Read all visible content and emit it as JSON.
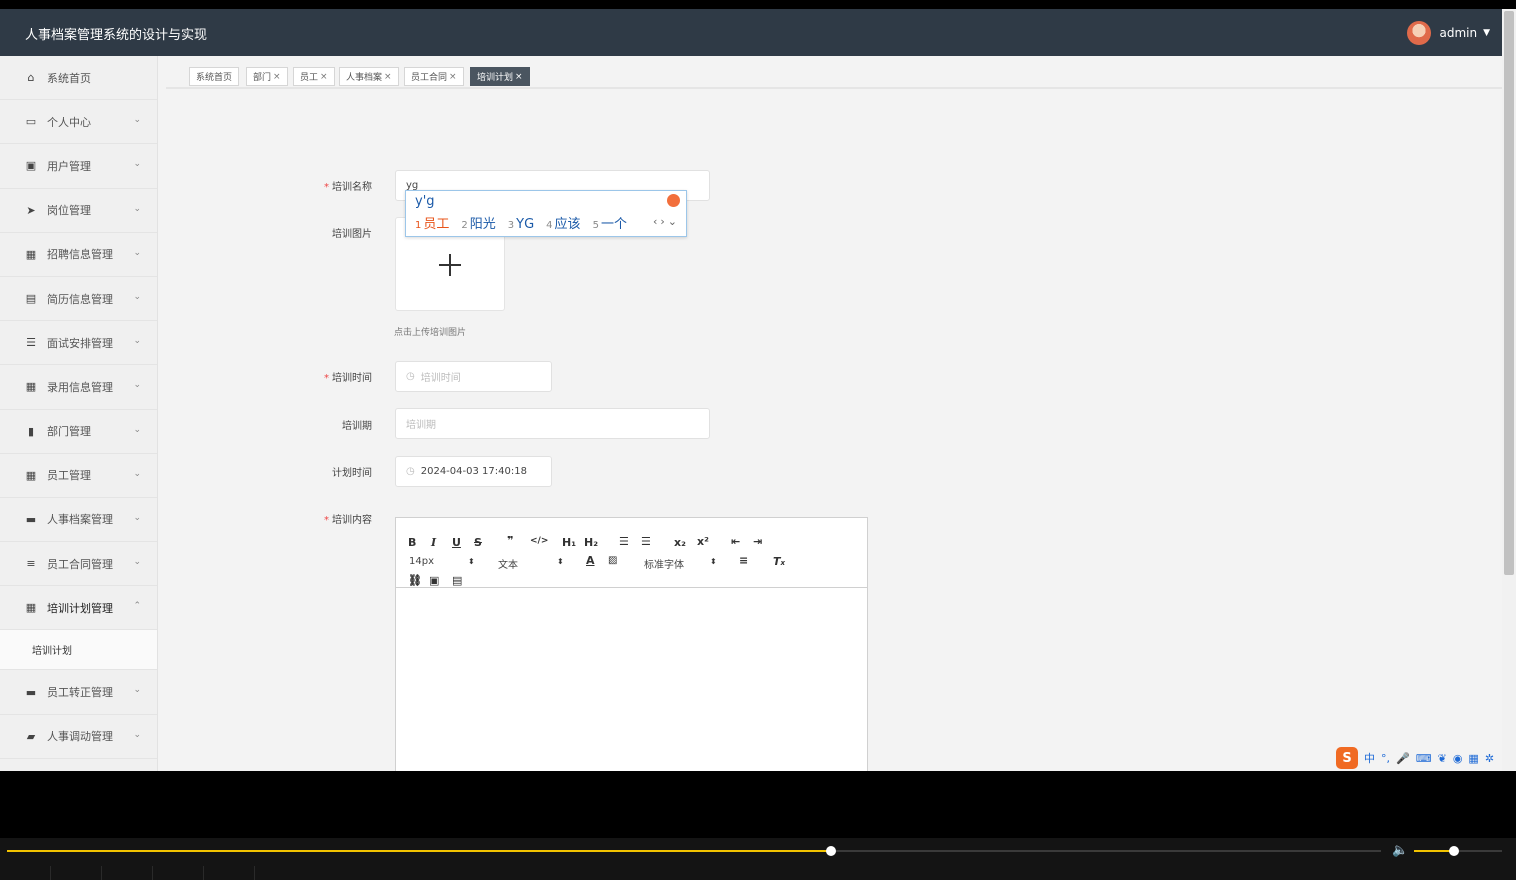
{
  "app": {
    "title": "人事档案管理系统的设计与实现",
    "user": "admin"
  },
  "sidebar": {
    "items": [
      {
        "label": "系统首页",
        "icon": "home-icon"
      },
      {
        "label": "个人中心",
        "icon": "calendar-icon"
      },
      {
        "label": "用户管理",
        "icon": "user-manage-icon"
      },
      {
        "label": "岗位管理",
        "icon": "send-icon"
      },
      {
        "label": "招聘信息管理",
        "icon": "grid-icon"
      },
      {
        "label": "简历信息管理",
        "icon": "clipboard-icon"
      },
      {
        "label": "面试安排管理",
        "icon": "list-icon"
      },
      {
        "label": "录用信息管理",
        "icon": "grid-icon"
      },
      {
        "label": "部门管理",
        "icon": "book-icon"
      },
      {
        "label": "员工管理",
        "icon": "table-icon"
      },
      {
        "label": "人事档案管理",
        "icon": "briefcase-icon"
      },
      {
        "label": "员工合同管理",
        "icon": "sliders-icon"
      },
      {
        "label": "培训计划管理",
        "icon": "grid-icon"
      },
      {
        "label": "员工转正管理",
        "icon": "chat-icon"
      },
      {
        "label": "人事调动管理",
        "icon": "ticket-icon"
      }
    ],
    "submenu": "培训计划"
  },
  "tabs": [
    {
      "label": "系统首页",
      "closable": false
    },
    {
      "label": "部门",
      "closable": true
    },
    {
      "label": "员工",
      "closable": true
    },
    {
      "label": "人事档案",
      "closable": true
    },
    {
      "label": "员工合同",
      "closable": true
    },
    {
      "label": "培训计划",
      "closable": true,
      "active": true
    }
  ],
  "form": {
    "name_label": "培训名称",
    "name_value": "yg",
    "image_label": "培训图片",
    "upload_hint": "点击上传培训图片",
    "time_label": "培训时间",
    "time_placeholder": "培训时间",
    "period_label": "培训期",
    "period_placeholder": "培训期",
    "plan_label": "计划时间",
    "plan_value": "2024-04-03 17:40:18",
    "content_label": "培训内容"
  },
  "ime": {
    "composition": "y'g",
    "candidates": [
      {
        "n": "1",
        "text": "员工"
      },
      {
        "n": "2",
        "text": "阳光"
      },
      {
        "n": "3",
        "text": "YG"
      },
      {
        "n": "4",
        "text": "应该"
      },
      {
        "n": "5",
        "text": "一个"
      }
    ]
  },
  "editor": {
    "font_size": "14px",
    "block_type": "文本",
    "font_family": "标准字体"
  },
  "imebar": {
    "mode": "中"
  },
  "player": {
    "progress": 0.6,
    "volume": 0.45
  }
}
